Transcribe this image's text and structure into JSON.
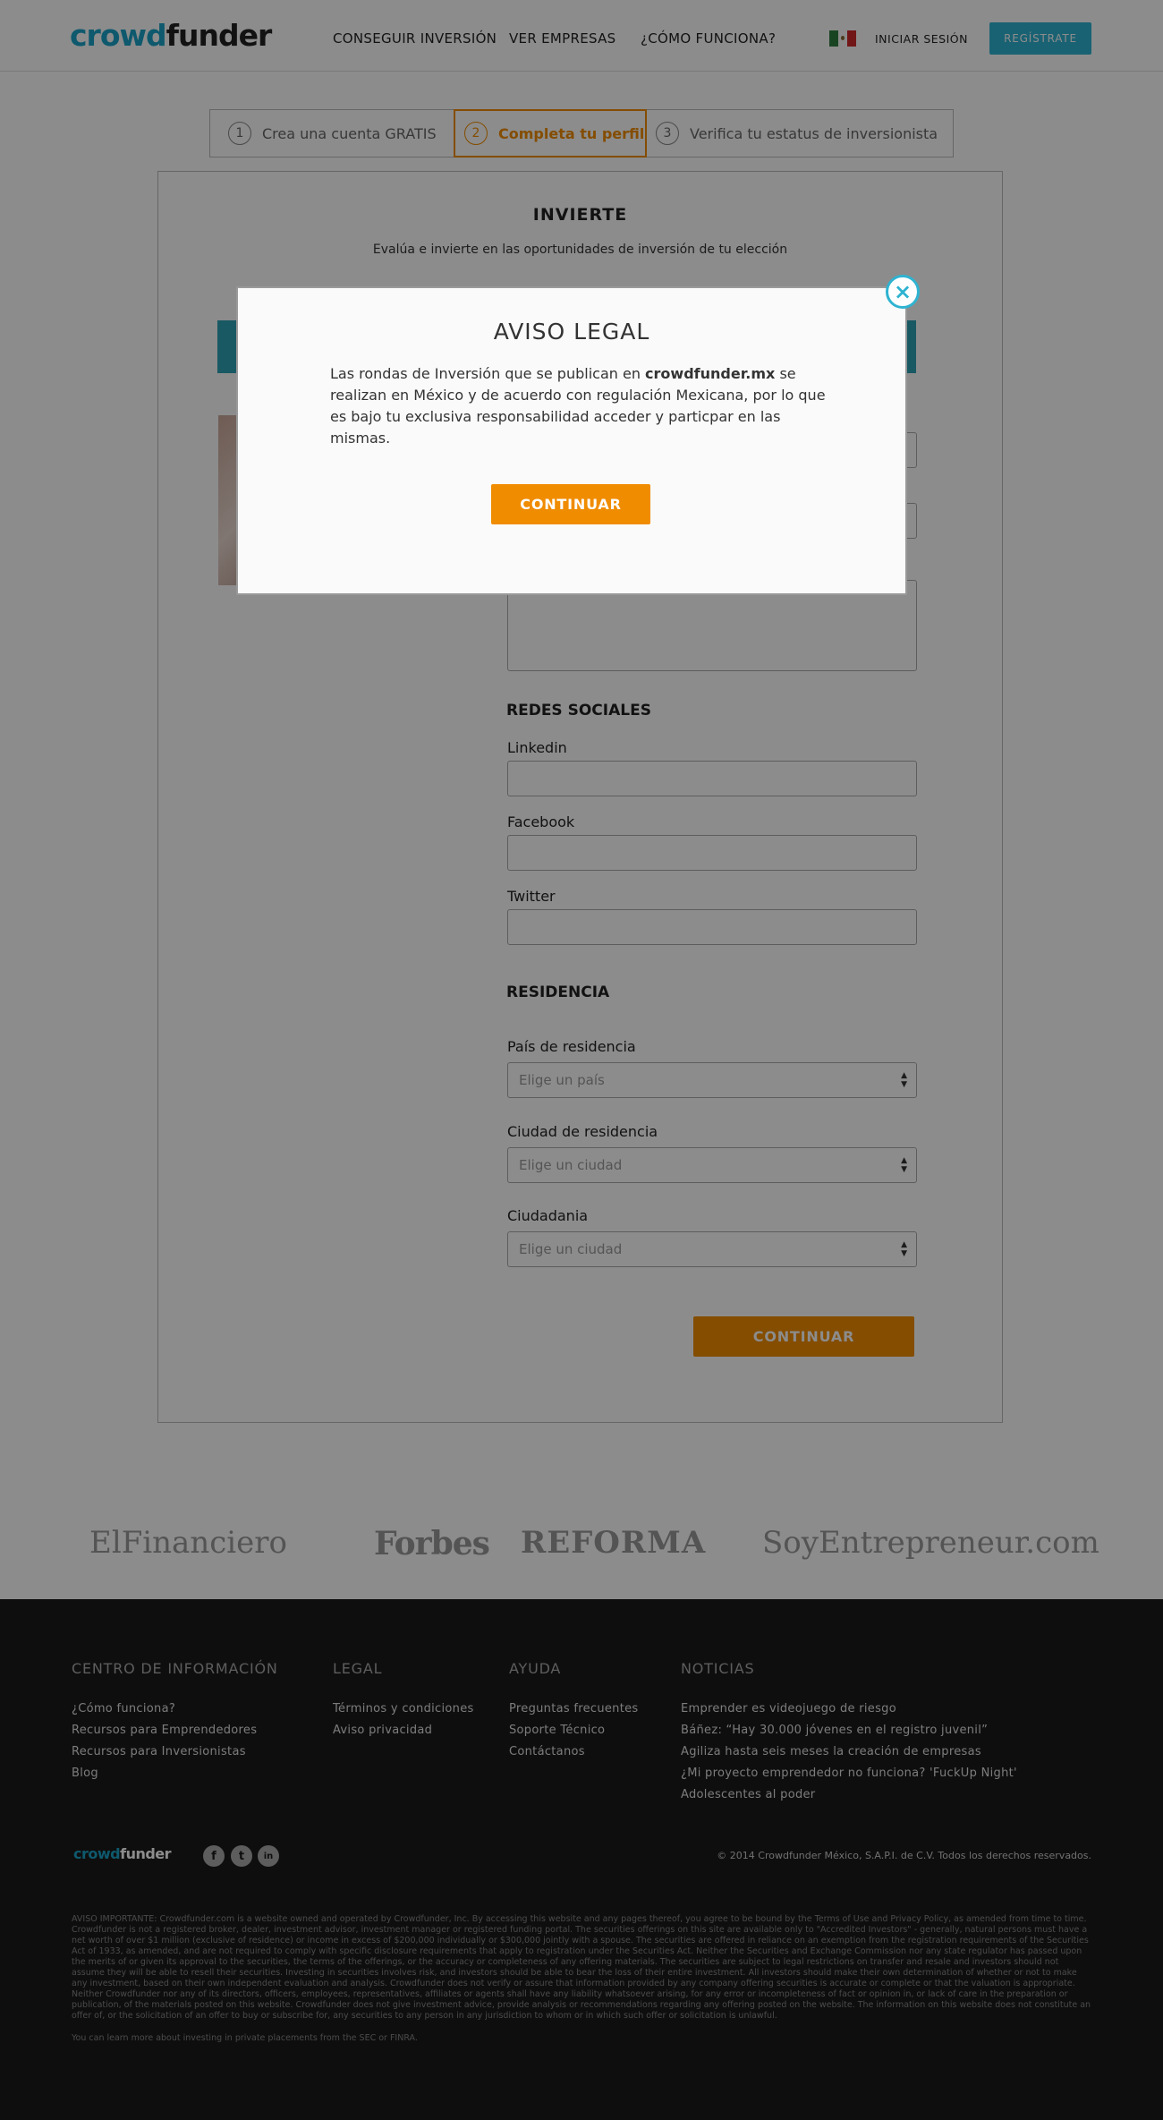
{
  "header": {
    "logo_part1": "crowd",
    "logo_part2": "funder",
    "nav": [
      "CONSEGUIR INVERSIÓN",
      "VER EMPRESAS",
      "¿CÓMO FUNCIONA?"
    ],
    "login": "INICIAR SESIÓN",
    "register": "REGÍSTRATE"
  },
  "steps": [
    {
      "num": "1",
      "label": "Crea una cuenta GRATIS"
    },
    {
      "num": "2",
      "label": "Completa tu perfil"
    },
    {
      "num": "3",
      "label": "Verifica tu estatus de inversionista"
    }
  ],
  "card": {
    "title": "INVIERTE",
    "subtitle": "Evalúa e invierte en las oportunidades de inversión de tu elección"
  },
  "form": {
    "social_title": "REDES SOCIALES",
    "linkedin": "Linkedin",
    "facebook": "Facebook",
    "twitter": "Twitter",
    "residence_title": "RESIDENCIA",
    "country_label": "País de residencia",
    "country_placeholder": "Elige un país",
    "city_label": "Ciudad de residencia",
    "city_placeholder": "Elige un ciudad",
    "citizenship_label": "Ciudadania",
    "citizenship_placeholder": "Elige un ciudad",
    "submit": "CONTINUAR"
  },
  "press": [
    "ElFinanciero",
    "Forbes",
    "REFORMA",
    "SoyEntrepreneur.com"
  ],
  "footer": {
    "col1_title": "CENTRO DE INFORMACIÓN",
    "col1_links": [
      "¿Cómo funciona?",
      "Recursos para Emprendedores",
      "Recursos para Inversionistas",
      "Blog"
    ],
    "col2_title": "LEGAL",
    "col2_links": [
      "Términos y condiciones",
      "Aviso privacidad"
    ],
    "col3_title": "AYUDA",
    "col3_links": [
      "Preguntas frecuentes",
      "Soporte Técnico",
      "Contáctanos"
    ],
    "col4_title": "NOTICIAS",
    "col4_links": [
      "Emprender es videojuego de riesgo",
      "Báñez: “Hay 30.000 jóvenes en el registro juvenil”",
      "Agiliza hasta seis meses la creación de empresas",
      "¿Mi proyecto emprendedor no funciona? 'FuckUp Night'",
      "Adolescentes al poder"
    ],
    "logo_part1": "crowd",
    "logo_part2": "funder",
    "social": [
      "f",
      "t",
      "in"
    ],
    "copyright": "© 2014 Crowdfunder México, S.A.P.I. de C.V. Todos los derechos reservados.",
    "disclaimer": "AVISO IMPORTANTE: Crowdfunder.com is a website owned and operated by Crowdfunder, Inc. By accessing this website and any pages thereof, you agree to be bound by the Terms of Use and Privacy Policy, as amended from time to time. Crowdfunder is not a registered broker, dealer, investment advisor, investment manager or registered funding portal. The securities offerings on this site are available only to \"Accredited Investors\" - generally, natural persons must have a net worth of over $1 million (exclusive of residence) or income in excess of $200,000 individually or $300,000 jointly with a spouse. The securities are offered in reliance on an exemption from the registration requirements of the Securities Act of 1933, as amended, and are not required to comply with specific disclosure requirements that apply to registration under the Securities Act. Neither the Securities and Exchange Commission nor any state regulator has passed upon the merits of or given its approval to the securities, the terms of the offerings, or the accuracy or completeness of any offering materials. The securities are subject to legal restrictions on transfer and resale and investors should not assume they will be able to resell their securities. Investing in securities involves risk, and investors should be able to bear the loss of their entire investment. All investors should make their own determination of whether or not to make any investment, based on their own independent evaluation and analysis. Crowdfunder does not verify or assure that information provided by any company offering securities is accurate or complete or that the valuation is appropriate. Neither Crowdfunder nor any of its directors, officers, employees, representatives, affiliates or agents shall have any liability whatsoever arising, for any error or incompleteness of fact or opinion in, or lack of care in the preparation or publication, of the materials posted on this website. Crowdfunder does not give investment advice, provide analysis or recommendations regarding any offering posted on the website. The information on this website does not constitute an offer of, or the solicitation of an offer to buy or subscribe for, any securities to any person in any jurisdiction to whom or in which such offer or solicitation is unlawful.",
    "sec_note": "You can learn more about investing in private placements from the SEC or FINRA."
  },
  "modal": {
    "title": "AVISO LEGAL",
    "body_pre": "Las rondas de Inversión que se publican en ",
    "body_bold": "crowdfunder.mx",
    "body_post": " se realizan en México y de acuerdo con regulación Mexicana, por lo que es bajo tu exclusiva responsabilidad acceder y particpar en las mismas.",
    "button": "CONTINUAR",
    "close": "×"
  },
  "colors": {
    "accent_orange": "#f08c00",
    "accent_teal": "#2fb3d1",
    "footer_bg": "#1a1a1a"
  }
}
